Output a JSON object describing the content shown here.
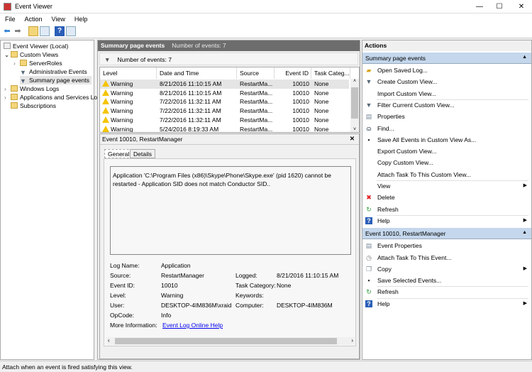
{
  "window": {
    "title": "Event Viewer",
    "minimize": "—",
    "maximize": "☐",
    "close": "✕"
  },
  "menu": [
    "File",
    "Action",
    "View",
    "Help"
  ],
  "toolbar": {
    "icons": [
      "back-arrow-icon",
      "forward-arrow-icon",
      "open-folder-icon",
      "show-hide-tree-icon",
      "help-icon",
      "show-hide-action-pane-icon"
    ]
  },
  "tree": [
    {
      "label": "Event Viewer (Local)",
      "expander": ""
    },
    {
      "label": "Custom Views",
      "expander": "⌄"
    },
    {
      "label": "ServerRoles",
      "expander": "›"
    },
    {
      "label": "Administrative Events",
      "expander": ""
    },
    {
      "label": "Summary page events",
      "expander": "",
      "selected": true
    },
    {
      "label": "Windows Logs",
      "expander": "›"
    },
    {
      "label": "Applications and Services Lo",
      "expander": "›"
    },
    {
      "label": "Subscriptions",
      "expander": ""
    }
  ],
  "main": {
    "header_title": "Summary page events",
    "header_count": "Number of events: 7",
    "filter_text": "Number of events: 7",
    "columns": [
      "Level",
      "Date and Time",
      "Source",
      "Event ID",
      "Task Categ..."
    ],
    "rows": [
      [
        "Warning",
        "8/21/2016 11:10:15 AM",
        "RestartMa...",
        "10010",
        "None"
      ],
      [
        "Warning",
        "8/21/2016 11:10:15 AM",
        "RestartMa...",
        "10010",
        "None"
      ],
      [
        "Warning",
        "7/22/2016 11:32:11 AM",
        "RestartMa...",
        "10010",
        "None"
      ],
      [
        "Warning",
        "7/22/2016 11:32:11 AM",
        "RestartMa...",
        "10010",
        "None"
      ],
      [
        "Warning",
        "7/22/2016 11:32:11 AM",
        "RestartMa...",
        "10010",
        "None"
      ],
      [
        "Warning",
        "5/24/2016 8:19:33 AM",
        "RestartMa...",
        "10010",
        "None"
      ]
    ]
  },
  "detail": {
    "title": "Event 10010, RestartManager",
    "close": "✕",
    "tabs": [
      "General",
      "Details"
    ],
    "message": "Application 'C:\\Program Files (x86)\\Skype\\Phone\\Skype.exe' (pid 1620) cannot be restarted - Application SID does not match Conductor SID..",
    "fields": {
      "log_name_label": "Log Name:",
      "log_name": "Application",
      "source_label": "Source:",
      "source": "RestartManager",
      "logged_label": "Logged:",
      "logged": "8/21/2016 11:10:15 AM",
      "event_id_label": "Event ID:",
      "event_id": "10010",
      "task_category_label": "Task Category:",
      "task_category": "None",
      "level_label": "Level:",
      "level": "Warning",
      "keywords_label": "Keywords:",
      "user_label": "User:",
      "user": "DESKTOP-4IM836M\\xraid",
      "computer_label": "Computer:",
      "computer": "DESKTOP-4IM836M",
      "opcode_label": "OpCode:",
      "opcode": "Info",
      "more_info_label": "More Information:",
      "more_info_link": "Event Log Online Help"
    }
  },
  "actions": {
    "title": "Actions",
    "sections": [
      {
        "title": "Summary page events",
        "items": [
          {
            "label": "Open Saved Log...",
            "icon": "open-folder-icon"
          },
          {
            "label": "Create Custom View...",
            "icon": "filter-icon"
          },
          {
            "label": "Import Custom View...",
            "icon": ""
          },
          {
            "label": "Filter Current Custom View...",
            "icon": "filter-icon",
            "sep": true
          },
          {
            "label": "Properties",
            "icon": "properties-icon"
          },
          {
            "label": "Find...",
            "icon": "binoculars-icon"
          },
          {
            "label": "Save All Events in Custom View As...",
            "icon": "save-icon"
          },
          {
            "label": "Export Custom View...",
            "icon": ""
          },
          {
            "label": "Copy Custom View...",
            "icon": ""
          },
          {
            "label": "Attach Task To This Custom View...",
            "icon": ""
          },
          {
            "label": "View",
            "icon": "",
            "submenu": true,
            "sep": true
          },
          {
            "label": "Delete",
            "icon": "delete-icon"
          },
          {
            "label": "Refresh",
            "icon": "refresh-icon"
          },
          {
            "label": "Help",
            "icon": "help-icon",
            "submenu": true,
            "sep": true
          }
        ]
      },
      {
        "title": "Event 10010, RestartManager",
        "items": [
          {
            "label": "Event Properties",
            "icon": "properties-icon"
          },
          {
            "label": "Attach Task To This Event...",
            "icon": "task-icon"
          },
          {
            "label": "Copy",
            "icon": "copy-icon",
            "submenu": true
          },
          {
            "label": "Save Selected Events...",
            "icon": "save-icon"
          },
          {
            "label": "Refresh",
            "icon": "refresh-icon",
            "sep": true
          },
          {
            "label": "Help",
            "icon": "help-icon",
            "submenu": true,
            "sep": true
          }
        ]
      }
    ]
  },
  "status": "Attach when an event is fired satisfying this view."
}
